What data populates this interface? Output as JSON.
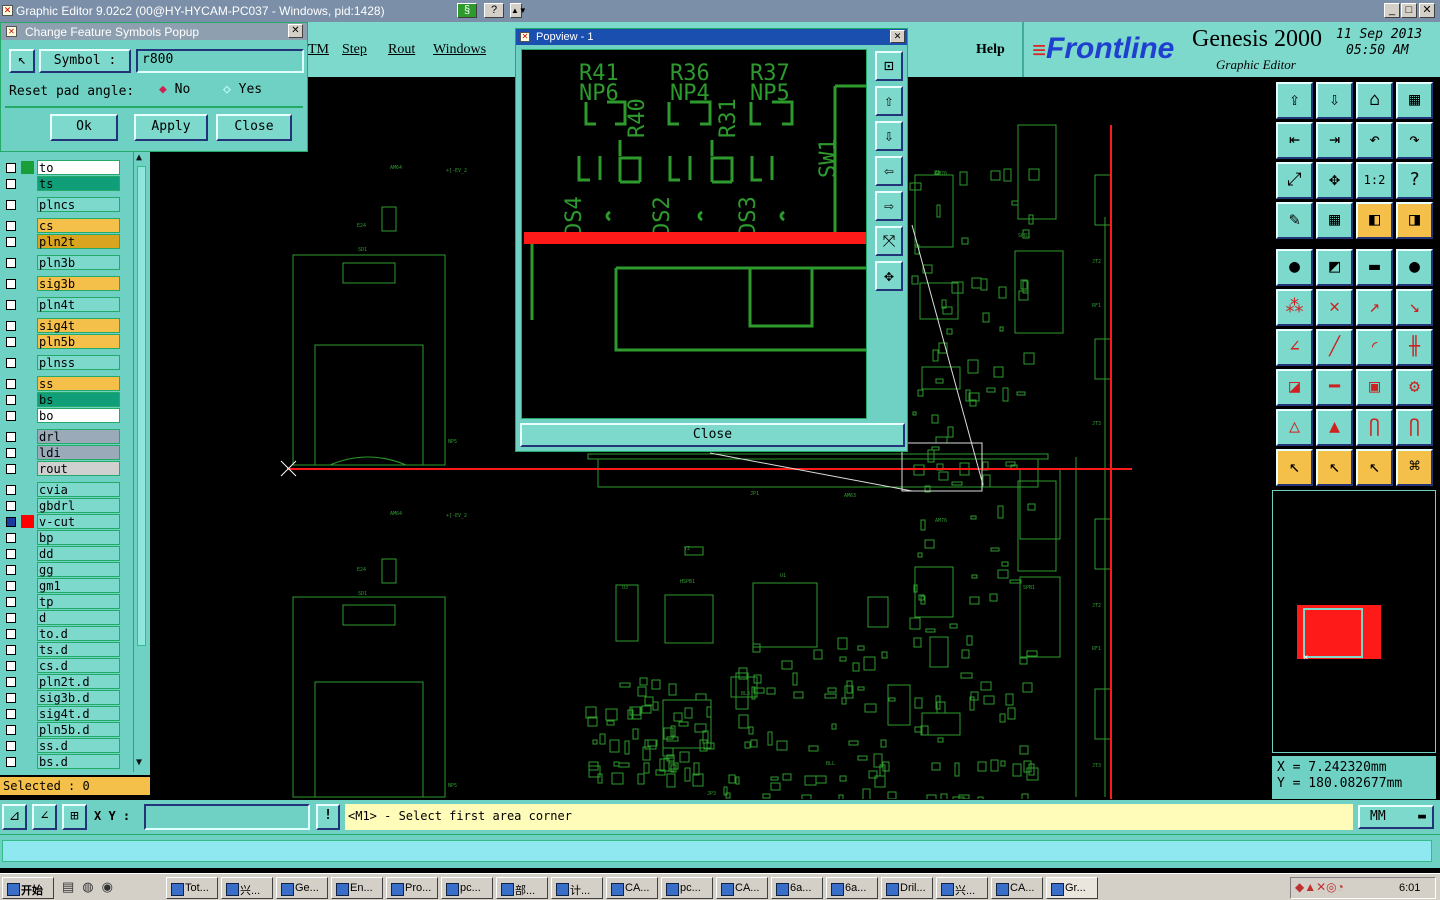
{
  "window": {
    "title": "Graphic Editor 9.02c2 (00@HY-HYCAM-PC037 - Windows, pid:1428)"
  },
  "menu": {
    "items": [
      "TM",
      "Step",
      "Rout",
      "Windows"
    ],
    "help": "Help"
  },
  "brand": {
    "logo": "Frontline",
    "product": "Genesis 2000",
    "subtitle": "Graphic Editor",
    "date": "11 Sep 2013",
    "time": "05:50 AM"
  },
  "popup": {
    "title": "Change Feature Symbols Popup",
    "symbol_label": "Symbol :",
    "symbol_value": "r800",
    "reset_label": "Reset pad angle:",
    "opt_no": "No",
    "opt_yes": "Yes",
    "ok": "Ok",
    "apply": "Apply",
    "close": "Close"
  },
  "layers": [
    {
      "name": "to",
      "bg": "#ffffff",
      "sw": "#1a9e3a",
      "gap": 0
    },
    {
      "name": "ts",
      "bg": "#0f9e78",
      "sw": "",
      "gap": 0
    },
    {
      "name": "plncs",
      "bg": "#7dd9cc",
      "sw": "",
      "gap": 1
    },
    {
      "name": "cs",
      "bg": "#f5c04a",
      "sw": "",
      "gap": 1
    },
    {
      "name": "pln2t",
      "bg": "#d9a520",
      "sw": "",
      "gap": 0
    },
    {
      "name": "pln3b",
      "bg": "#7dd9cc",
      "sw": "",
      "gap": 1
    },
    {
      "name": "sig3b",
      "bg": "#f5c04a",
      "sw": "",
      "gap": 1
    },
    {
      "name": "pln4t",
      "bg": "#7dd9cc",
      "sw": "",
      "gap": 1
    },
    {
      "name": "sig4t",
      "bg": "#f5c04a",
      "sw": "",
      "gap": 1
    },
    {
      "name": "pln5b",
      "bg": "#f5c04a",
      "sw": "",
      "gap": 0
    },
    {
      "name": "plnss",
      "bg": "#7dd9cc",
      "sw": "",
      "gap": 1
    },
    {
      "name": "ss",
      "bg": "#f5c04a",
      "sw": "",
      "gap": 1
    },
    {
      "name": "bs",
      "bg": "#0f9e78",
      "sw": "",
      "gap": 0
    },
    {
      "name": "bo",
      "bg": "#ffffff",
      "sw": "",
      "gap": 0
    },
    {
      "name": "drl",
      "bg": "#9aaab8",
      "sw": "",
      "gap": 1
    },
    {
      "name": "ldi",
      "bg": "#9aaab8",
      "sw": "",
      "gap": 0
    },
    {
      "name": "rout",
      "bg": "#d0d0d0",
      "sw": "",
      "gap": 0
    },
    {
      "name": "cvia",
      "bg": "#7dd9cc",
      "sw": "",
      "gap": 1
    },
    {
      "name": "gbdrl",
      "bg": "#7dd9cc",
      "sw": "",
      "gap": 0
    },
    {
      "name": "v-cut",
      "bg": "#7dd9cc",
      "sw": "#ff0000",
      "gap": 0,
      "active": true
    },
    {
      "name": "bp",
      "bg": "#7dd9cc",
      "sw": "",
      "gap": 0
    },
    {
      "name": "dd",
      "bg": "#7dd9cc",
      "sw": "",
      "gap": 0
    },
    {
      "name": "gg",
      "bg": "#7dd9cc",
      "sw": "",
      "gap": 0
    },
    {
      "name": "gm1",
      "bg": "#7dd9cc",
      "sw": "",
      "gap": 0
    },
    {
      "name": "tp",
      "bg": "#7dd9cc",
      "sw": "",
      "gap": 0
    },
    {
      "name": "d",
      "bg": "#7dd9cc",
      "sw": "",
      "gap": 0
    },
    {
      "name": "to.d",
      "bg": "#7dd9cc",
      "sw": "",
      "gap": 0
    },
    {
      "name": "ts.d",
      "bg": "#7dd9cc",
      "sw": "",
      "gap": 0
    },
    {
      "name": "cs.d",
      "bg": "#7dd9cc",
      "sw": "",
      "gap": 0
    },
    {
      "name": "pln2t.d",
      "bg": "#7dd9cc",
      "sw": "",
      "gap": 0
    },
    {
      "name": "sig3b.d",
      "bg": "#7dd9cc",
      "sw": "",
      "gap": 0
    },
    {
      "name": "sig4t.d",
      "bg": "#7dd9cc",
      "sw": "",
      "gap": 0
    },
    {
      "name": "pln5b.d",
      "bg": "#7dd9cc",
      "sw": "",
      "gap": 0
    },
    {
      "name": "ss.d",
      "bg": "#7dd9cc",
      "sw": "",
      "gap": 0
    },
    {
      "name": "bs.d",
      "bg": "#7dd9cc",
      "sw": "",
      "gap": 0
    }
  ],
  "selected": "Selected : 0",
  "popview": {
    "title": "Popview - 1",
    "close": "Close",
    "labels": [
      "R41",
      "NP6",
      "R40",
      "R36",
      "NP4",
      "R31",
      "R37",
      "NP5",
      "SW1",
      "DS4",
      "DS2",
      "DS3"
    ]
  },
  "coords": {
    "x": "X  =  7.242320mm",
    "y": "Y  = 180.082677mm"
  },
  "status": {
    "xy_label": "X Y :",
    "message": "<M1> - Select first area corner",
    "units": "MM"
  },
  "taskbar": {
    "start": "开始",
    "tasks": [
      "Tot...",
      "兴...",
      "Ge...",
      "En...",
      "Pro...",
      "pc...",
      "部...",
      "计...",
      "CA...",
      "pc...",
      "CA...",
      "6a...",
      "6a...",
      "Dril...",
      "兴...",
      "CA...",
      "Gr..."
    ],
    "clock": "6:01"
  },
  "colors": {
    "panel": "#6fd1c3",
    "button": "#7dd9cc",
    "trace": "#2e9a2e",
    "cursor": "#ff1a1a"
  }
}
